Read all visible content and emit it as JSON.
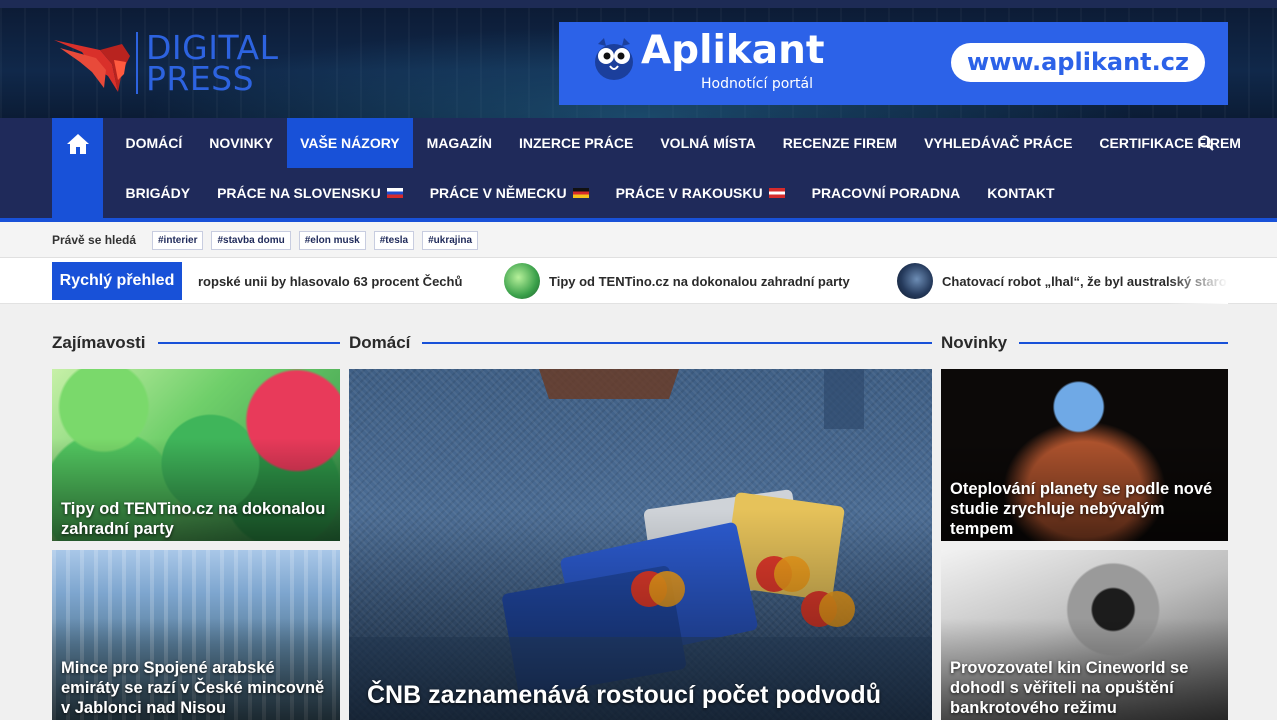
{
  "header": {
    "logo": {
      "line1": "DIGITAL",
      "line2": "PRESS"
    },
    "banner": {
      "title": "Aplikant",
      "subtitle": "Hodnotící portál",
      "url": "www.aplikant.cz"
    }
  },
  "nav": {
    "row1": [
      "DOMÁCÍ",
      "NOVINKY",
      "VAŠE NÁZORY",
      "MAGAZÍN",
      "INZERCE PRÁCE",
      "VOLNÁ MÍSTA",
      "RECENZE FIREM",
      "VYHLEDÁVAČ PRÁCE",
      "CERTIFIKACE FIREM"
    ],
    "row2": [
      "BRIGÁDY",
      "PRÁCE NA SLOVENSKU",
      "PRÁCE V NĚMECKU",
      "PRÁCE V RAKOUSKU",
      "PRACOVNÍ PORADNA",
      "KONTAKT"
    ],
    "active": "VAŠE NÁZORY"
  },
  "trending": {
    "label": "Právě se hledá",
    "tags": [
      "#interier",
      "#stavba domu",
      "#elon musk",
      "#tesla",
      "#ukrajina"
    ]
  },
  "ticker": {
    "label": "Rychlý přehled",
    "items": [
      "ropské unii by hlasovalo 63 procent Čechů",
      "Tipy od TENTino.cz na dokonalou zahradní party",
      "Chatovací robot „lhal“, že byl australský staro"
    ]
  },
  "sections": {
    "left": {
      "title": "Zajímavosti",
      "cards": [
        "Tipy od TENTino.cz na dokonalou zahradní party",
        "Mince pro Spojené arabské emiráty se razí v České mincovně v Jablonci nad Nisou"
      ]
    },
    "center": {
      "title": "Domácí",
      "cards": [
        "ČNB zaznamenává rostoucí počet podvodů"
      ]
    },
    "right": {
      "title": "Novinky",
      "cards": [
        "Oteplování planety se podle nové studie zrychluje nebývalým tempem",
        "Provozovatel kin Cineworld se dohodl s věřiteli na opuštění bankrotového režimu"
      ]
    }
  }
}
